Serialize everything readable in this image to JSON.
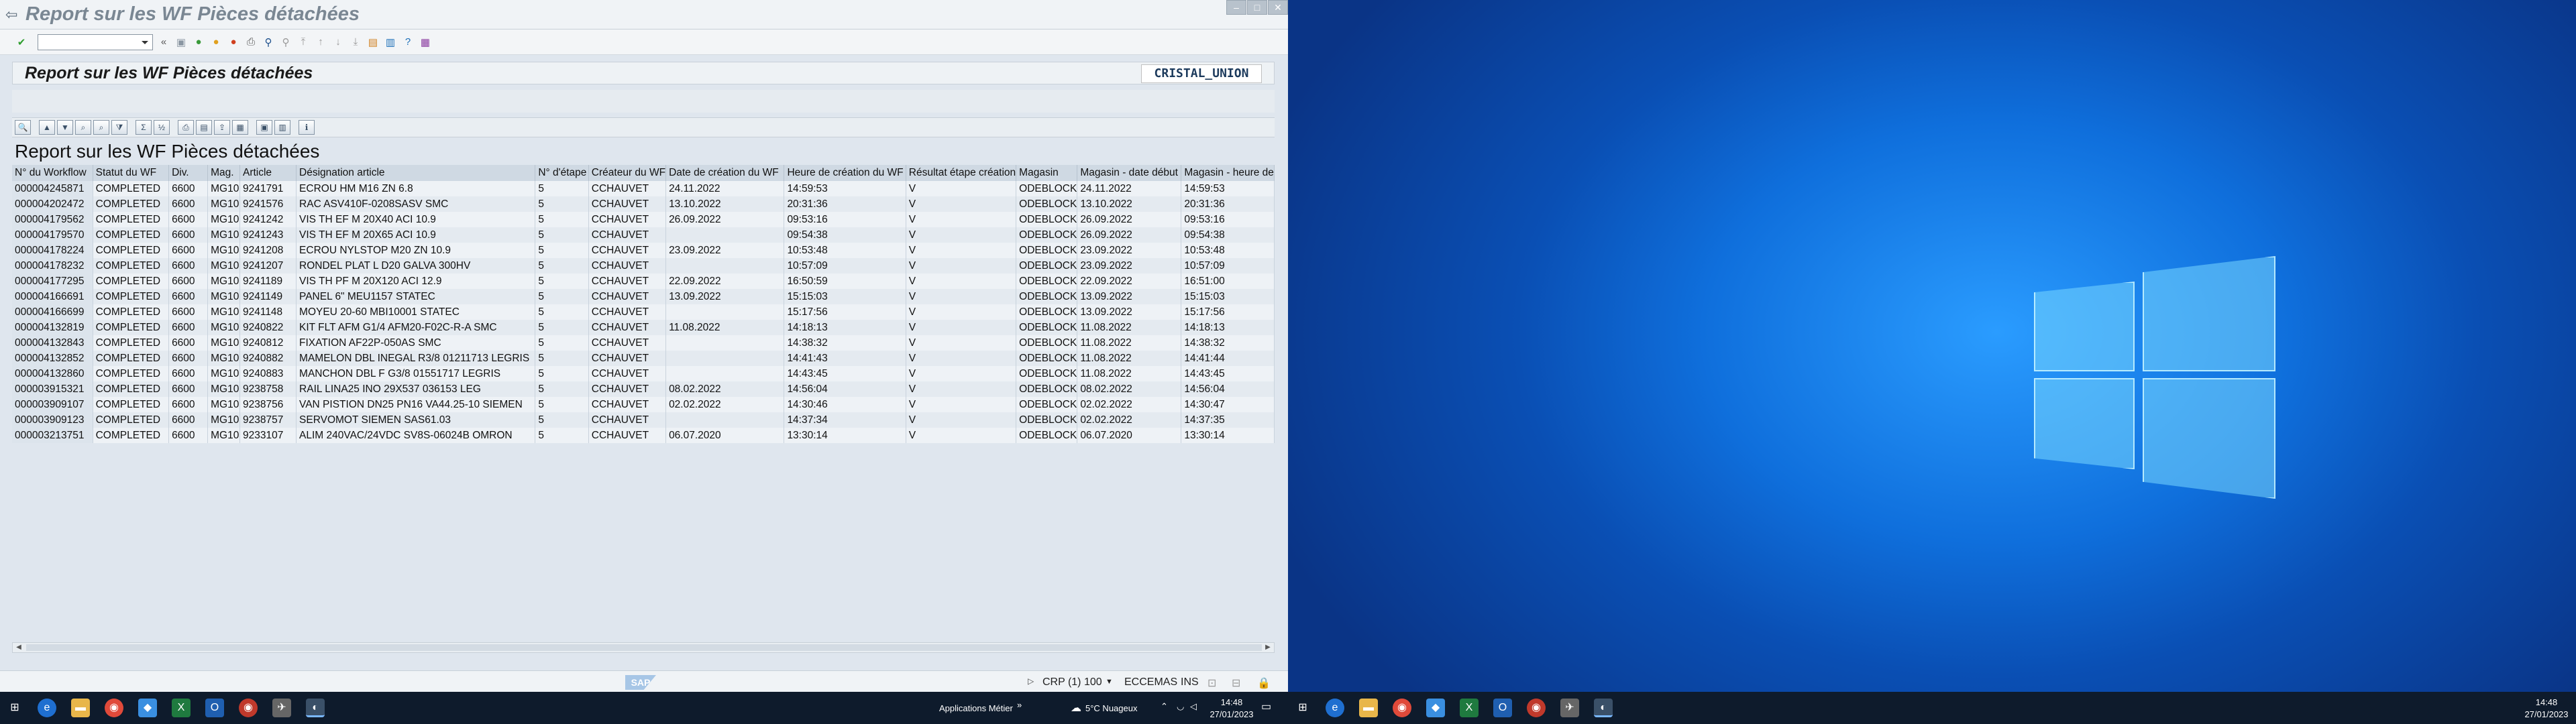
{
  "window": {
    "title": "Report sur les WF Pièces détachées"
  },
  "header": {
    "title": "Report sur les WF Pièces détachées",
    "logo_text": "CRISTAL_UNION"
  },
  "report": {
    "title": "Report sur les WF Pièces détachées"
  },
  "table": {
    "columns": [
      "N° du Workflow",
      "Statut du WF",
      "Div.",
      "Mag.",
      "Article",
      "Désignation article",
      "N° d'étape",
      "Créateur du WF",
      "Date de création du WF",
      "Heure de création du WF",
      "Résultat étape création",
      "Magasin",
      "Magasin - date début",
      "Magasin - heure de"
    ],
    "rows": [
      [
        "000004245871",
        "COMPLETED",
        "6600",
        "MG10",
        "9241791",
        "ECROU HM M16 ZN 6.8",
        "5",
        "CCHAUVET",
        "24.11.2022",
        "14:59:53",
        "V",
        "ODEBLOCK",
        "24.11.2022",
        "14:59:53"
      ],
      [
        "000004202472",
        "COMPLETED",
        "6600",
        "MG10",
        "9241576",
        "RAC ASV410F-0208SASV SMC",
        "5",
        "CCHAUVET",
        "13.10.2022",
        "20:31:36",
        "V",
        "ODEBLOCK",
        "13.10.2022",
        "20:31:36"
      ],
      [
        "000004179562",
        "COMPLETED",
        "6600",
        "MG10",
        "9241242",
        "VIS TH EF M 20X40 ACI 10.9",
        "5",
        "CCHAUVET",
        "26.09.2022",
        "09:53:16",
        "V",
        "ODEBLOCK",
        "26.09.2022",
        "09:53:16"
      ],
      [
        "000004179570",
        "COMPLETED",
        "6600",
        "MG10",
        "9241243",
        "VIS TH EF M 20X65 ACI 10.9",
        "5",
        "CCHAUVET",
        "",
        "09:54:38",
        "V",
        "ODEBLOCK",
        "26.09.2022",
        "09:54:38"
      ],
      [
        "000004178224",
        "COMPLETED",
        "6600",
        "MG10",
        "9241208",
        "ECROU NYLSTOP M20 ZN 10.9",
        "5",
        "CCHAUVET",
        "23.09.2022",
        "10:53:48",
        "V",
        "ODEBLOCK",
        "23.09.2022",
        "10:53:48"
      ],
      [
        "000004178232",
        "COMPLETED",
        "6600",
        "MG10",
        "9241207",
        "RONDEL PLAT L D20 GALVA 300HV",
        "5",
        "CCHAUVET",
        "",
        "10:57:09",
        "V",
        "ODEBLOCK",
        "23.09.2022",
        "10:57:09"
      ],
      [
        "000004177295",
        "COMPLETED",
        "6600",
        "MG10",
        "9241189",
        "VIS TH PF M 20X120 ACI 12.9",
        "5",
        "CCHAUVET",
        "22.09.2022",
        "16:50:59",
        "V",
        "ODEBLOCK",
        "22.09.2022",
        "16:51:00"
      ],
      [
        "000004166691",
        "COMPLETED",
        "6600",
        "MG10",
        "9241149",
        "PANEL 6\" MEU1157 STATEC",
        "5",
        "CCHAUVET",
        "13.09.2022",
        "15:15:03",
        "V",
        "ODEBLOCK",
        "13.09.2022",
        "15:15:03"
      ],
      [
        "000004166699",
        "COMPLETED",
        "6600",
        "MG10",
        "9241148",
        "MOYEU 20-60 MBI10001 STATEC",
        "5",
        "CCHAUVET",
        "",
        "15:17:56",
        "V",
        "ODEBLOCK",
        "13.09.2022",
        "15:17:56"
      ],
      [
        "000004132819",
        "COMPLETED",
        "6600",
        "MG10",
        "9240822",
        "KIT FLT AFM G1/4 AFM20-F02C-R-A SMC",
        "5",
        "CCHAUVET",
        "11.08.2022",
        "14:18:13",
        "V",
        "ODEBLOCK",
        "11.08.2022",
        "14:18:13"
      ],
      [
        "000004132843",
        "COMPLETED",
        "6600",
        "MG10",
        "9240812",
        "FIXATION AF22P-050AS SMC",
        "5",
        "CCHAUVET",
        "",
        "14:38:32",
        "V",
        "ODEBLOCK",
        "11.08.2022",
        "14:38:32"
      ],
      [
        "000004132852",
        "COMPLETED",
        "6600",
        "MG10",
        "9240882",
        "MAMELON DBL INEGAL R3/8  01211713 LEGRIS",
        "5",
        "CCHAUVET",
        "",
        "14:41:43",
        "V",
        "ODEBLOCK",
        "11.08.2022",
        "14:41:44"
      ],
      [
        "000004132860",
        "COMPLETED",
        "6600",
        "MG10",
        "9240883",
        "MANCHON DBL F G3/8 01551717 LEGRIS",
        "5",
        "CCHAUVET",
        "",
        "14:43:45",
        "V",
        "ODEBLOCK",
        "11.08.2022",
        "14:43:45"
      ],
      [
        "000003915321",
        "COMPLETED",
        "6600",
        "MG10",
        "9238758",
        "RAIL LINA25 INO 29X537 036153 LEG",
        "5",
        "CCHAUVET",
        "08.02.2022",
        "14:56:04",
        "V",
        "ODEBLOCK",
        "08.02.2022",
        "14:56:04"
      ],
      [
        "000003909107",
        "COMPLETED",
        "6600",
        "MG10",
        "9238756",
        "VAN PISTION DN25 PN16 VA44.25-10 SIEMEN",
        "5",
        "CCHAUVET",
        "02.02.2022",
        "14:30:46",
        "V",
        "ODEBLOCK",
        "02.02.2022",
        "14:30:47"
      ],
      [
        "000003909123",
        "COMPLETED",
        "6600",
        "MG10",
        "9238757",
        "SERVOMOT SIEMEN SAS61.03",
        "5",
        "CCHAUVET",
        "",
        "14:37:34",
        "V",
        "ODEBLOCK",
        "02.02.2022",
        "14:37:35"
      ],
      [
        "000003213751",
        "COMPLETED",
        "6600",
        "MG10",
        "9233107",
        "ALIM 240VAC/24VDC SV8S-06024B OMRON",
        "5",
        "CCHAUVET",
        "06.07.2020",
        "13:30:14",
        "V",
        "ODEBLOCK",
        "06.07.2020",
        "13:30:14"
      ]
    ]
  },
  "status": {
    "system": "CRP (1) 100",
    "user": "ECCEMAS",
    "mode": "INS",
    "sap": "SAP"
  },
  "taskbar_left": {
    "group_label": "Applications Métier",
    "weather": "5°C  Nuageux",
    "time": "14:48",
    "date": "27/01/2023"
  },
  "taskbar_right": {
    "time": "14:48",
    "date": "27/01/2023"
  }
}
